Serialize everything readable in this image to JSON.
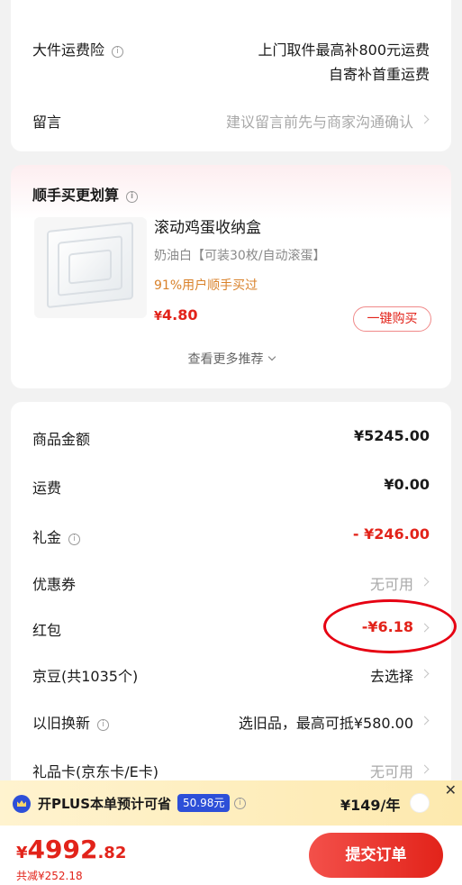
{
  "shipping_insurance": {
    "label": "大件运费险",
    "line1": "上门取件最高补800元运费",
    "line2": "自寄补首重运费"
  },
  "message": {
    "label": "留言",
    "placeholder": "建议留言前先与商家沟通确认"
  },
  "addon": {
    "title": "顺手买更划算",
    "product_name": "滚动鸡蛋收纳盒",
    "product_spec": "奶油白【可装30枚/自动滚蛋】",
    "social_proof": "91%用户顺手买过",
    "price_symbol": "¥",
    "price": "4.80",
    "buy_label": "一键购买",
    "more_label": "查看更多推荐"
  },
  "summary": {
    "goods_amount": {
      "label": "商品金额",
      "value": "¥5245.00"
    },
    "shipping": {
      "label": "运费",
      "value": "¥0.00"
    },
    "gift_money": {
      "label": "礼金",
      "value": "- ¥246.00"
    },
    "coupon": {
      "label": "优惠券",
      "value": "无可用"
    },
    "red_packet": {
      "label": "红包",
      "value": "-¥6.18"
    },
    "jd_beans": {
      "label": "京豆(共1035个)",
      "value": "去选择"
    },
    "trade_in": {
      "label": "以旧换新",
      "value": "选旧品，最高可抵¥580.00"
    },
    "gift_card": {
      "label": "礼品卡(京东卡/E卡)",
      "value": "无可用"
    }
  },
  "plus_bar": {
    "text": "开PLUS本单预计可省",
    "save_amount": "50.98元",
    "price": "¥149/年",
    "close": "✕"
  },
  "checkout": {
    "currency": "¥",
    "total_int": "4992",
    "total_dec": ".82",
    "discount": "共减¥252.18",
    "submit_label": "提交订单"
  },
  "colors": {
    "accent": "#e2231a",
    "plus_blue": "#2d4fd8",
    "annotation_circle": "#e60012"
  }
}
